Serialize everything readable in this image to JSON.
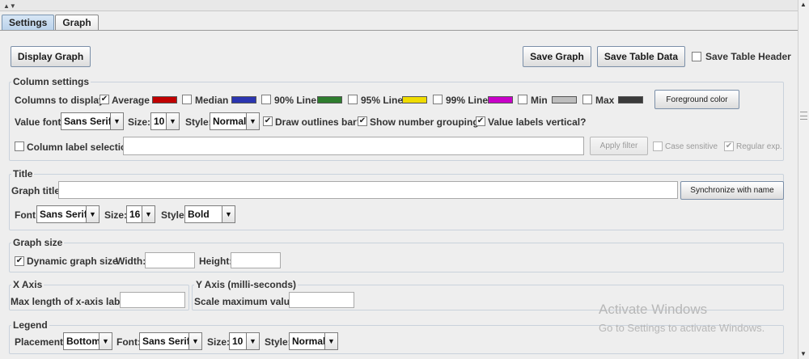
{
  "tabs": [
    {
      "label": "Settings"
    },
    {
      "label": "Graph"
    }
  ],
  "toolbar": {
    "display_graph": "Display Graph",
    "save_graph": "Save Graph",
    "save_table_data": "Save Table Data",
    "save_table_header": "Save Table Header"
  },
  "column_settings": {
    "title": "Column settings",
    "columns_to_display": "Columns to display:",
    "columns": [
      {
        "label": "Average",
        "checked": true,
        "color": "#c00000"
      },
      {
        "label": "Median",
        "checked": false,
        "color": "#2b35b0"
      },
      {
        "label": "90% Line",
        "checked": false,
        "color": "#2e7d2e"
      },
      {
        "label": "95% Line",
        "checked": false,
        "color": "#f0dc00"
      },
      {
        "label": "99% Line",
        "checked": false,
        "color": "#c800c8"
      },
      {
        "label": "Min",
        "checked": false,
        "color": "#bdbdbd"
      },
      {
        "label": "Max",
        "checked": false,
        "color": "#3a3a3a"
      }
    ],
    "foreground_color": "Foreground color",
    "value_font_label": "Value font:",
    "value_font": "Sans Serif",
    "size_label": "Size:",
    "size": "10",
    "style_label": "Style:",
    "style": "Normal",
    "draw_outlines": "Draw outlines bar?",
    "show_number_grouping": "Show number grouping?",
    "value_labels_vertical": "Value labels vertical?",
    "column_label_selection": "Column label selection:",
    "apply_filter": "Apply filter",
    "case_sensitive": "Case sensitive",
    "regular_exp": "Regular exp."
  },
  "title_section": {
    "title": "Title",
    "graph_title_label": "Graph title:",
    "synchronize": "Synchronize with name",
    "font_label": "Font:",
    "font": "Sans Serif",
    "size_label": "Size:",
    "size": "16",
    "style_label": "Style:",
    "style": "Bold"
  },
  "graph_size": {
    "title": "Graph size",
    "dynamic": "Dynamic graph size",
    "width_label": "Width:",
    "height_label": "Height:"
  },
  "x_axis": {
    "title": "X Axis",
    "max_length_label": "Max length of x-axis label:"
  },
  "y_axis": {
    "title": "Y Axis (milli-seconds)",
    "scale_max_label": "Scale maximum value:"
  },
  "legend": {
    "title": "Legend",
    "placement_label": "Placement:",
    "placement": "Bottom",
    "font_label": "Font:",
    "font": "Sans Serif",
    "size_label": "Size:",
    "size": "10",
    "style_label": "Style:",
    "style": "Normal"
  },
  "watermark": {
    "line1": "Activate Windows",
    "line2": "Go to Settings to activate Windows."
  },
  "icons": {
    "check": "✔",
    "dropdown": "▼"
  }
}
